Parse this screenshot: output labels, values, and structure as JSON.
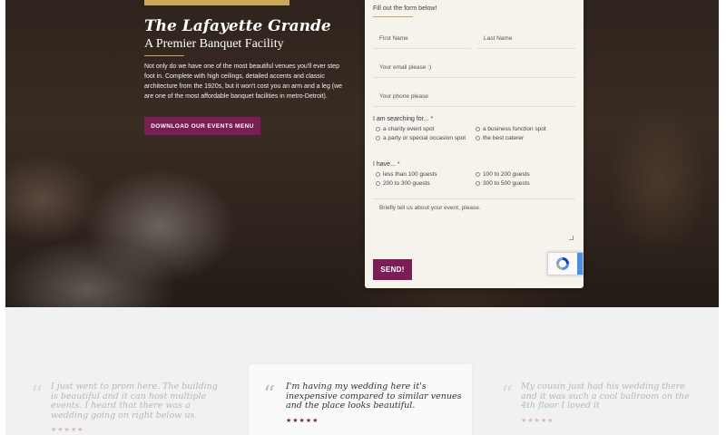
{
  "hero": {
    "title": "The Lafayette Grande",
    "subtitle": "A Premier Banquet Facility",
    "description": "Not only do we have one of the most beautiful venues you'll ever step foot in. Complete with high ceilings, detailed accents and classic architecture from the 1920s, but it won't cost you an arm and a leg (we are one of the most affordable banquet facilities in metro-Detroit).",
    "menu_button": "DOWNLOAD OUR EVENTS MENU"
  },
  "form": {
    "intro": "Fill out the form below!",
    "first_name_placeholder": "First Name",
    "last_name_placeholder": "Last Name",
    "email_placeholder": "Your email please :)",
    "phone_placeholder": "Your phone please",
    "searching_label": "I am searching for...",
    "required_mark": "*",
    "searching_options": [
      "a charity event spot",
      "a business function spot",
      "a party or special occasion spot",
      "the best caterer"
    ],
    "have_label": "I have...",
    "have_options": [
      "less than 100 guests",
      "100 to 200 guests",
      "200 to 300 guests",
      "300 to 500 guests"
    ],
    "message_placeholder": "Briefly tell us about your event, please.",
    "send_label": "SEND!"
  },
  "testimonials": [
    {
      "quote_mark": "“",
      "text": "I just went to prom here. The building is beautiful and it can host multiple events. I heard that there was a wedding going on right below us.",
      "stars": "★★★★★"
    },
    {
      "quote_mark": "“",
      "text": "I'm having my wedding here it's inexpensive compared to similar venues and the place looks beautiful.",
      "stars": "★★★★★"
    },
    {
      "quote_mark": "“",
      "text": "My cousin just had his wedding there and it was such a cool ballroom on the 4th floor I loved it",
      "stars": "★★★★★"
    }
  ],
  "colors": {
    "accent_purple": "#7a1e55",
    "gold": "#c9a85a"
  },
  "icons": {
    "recaptcha": "recaptcha-icon",
    "quote": "quote-icon",
    "star": "star-icon"
  }
}
